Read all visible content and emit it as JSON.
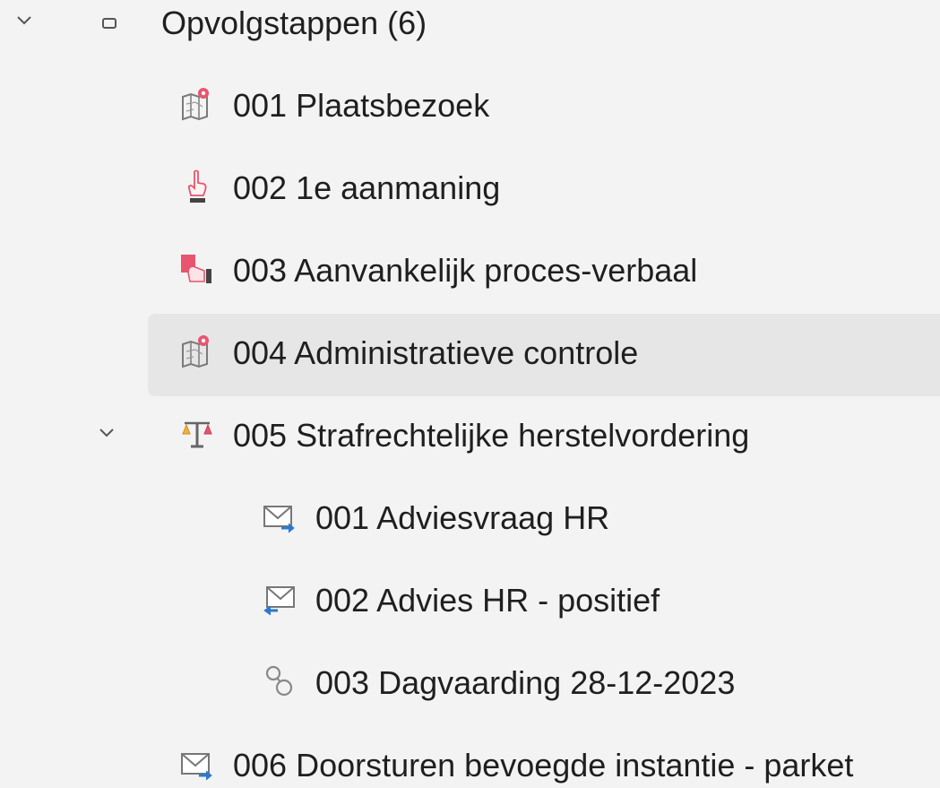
{
  "tree": {
    "root": {
      "label": "Opvolgstappen (6)",
      "expand_icon": "chevron-down-icon",
      "node_icon": "square-outline-icon"
    },
    "items": [
      {
        "label": "001 Plaatsbezoek",
        "icon": "map-pin-icon"
      },
      {
        "label": "002 1e aanmaning",
        "icon": "pointing-finger-icon"
      },
      {
        "label": "003 Aanvankelijk proces-verbaal",
        "icon": "document-stamp-icon"
      },
      {
        "label": "004 Administratieve controle",
        "icon": "map-pin-icon",
        "selected": true
      },
      {
        "label": "005 Strafrechtelijke herstelvordering",
        "icon": "scales-icon",
        "expand_icon": "chevron-down-icon",
        "children": [
          {
            "label": "001 Adviesvraag HR",
            "icon": "mail-outgoing-icon"
          },
          {
            "label": "002 Advies HR - positief",
            "icon": "mail-incoming-icon"
          },
          {
            "label": "003 Dagvaarding 28-12-2023",
            "icon": "chain-link-icon"
          }
        ]
      },
      {
        "label": "006 Doorsturen bevoegde instantie - parket",
        "icon": "mail-outgoing-icon"
      }
    ],
    "colors": {
      "background": "#f3f3f3",
      "selected_background": "#e6e6e6",
      "text": "#1f1f1f",
      "icon_red": "#e8556f",
      "icon_blue": "#2b79d0",
      "icon_gray": "#7a7a7a"
    }
  }
}
